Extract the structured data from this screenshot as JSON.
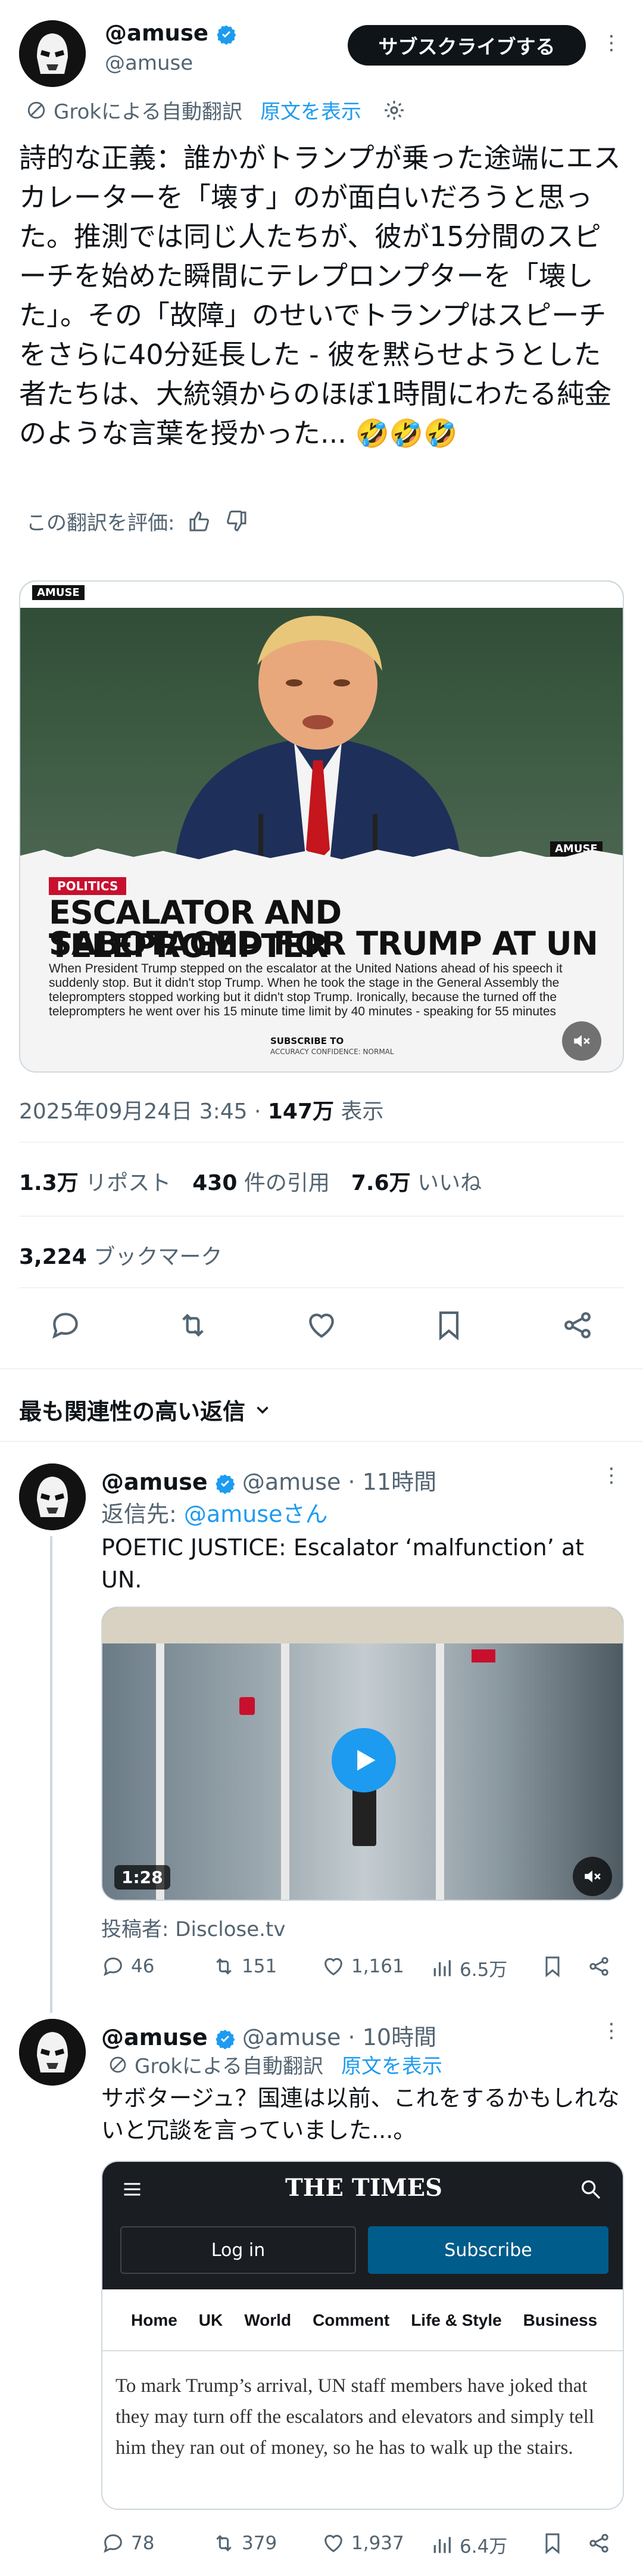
{
  "tweet": {
    "display_name": "@amuse",
    "handle": "@amuse",
    "subscribe_label": "サブスクライブする",
    "translation_note": "Grokによる自動翻訳",
    "show_original": "原文を表示",
    "text": "詩的な正義：誰かがトランプが乗った途端にエスカレーターを「壊す」のが面白いだろうと思った。推測では同じ人たちが、彼が15分間のスピーチを始めた瞬間にテレプロンプターを「壊した」。その「故障」のせいでトランプはスピーチをさらに40分延長した - 彼を黙らせようとした者たちは、大統領からのほぼ1時間にわたる純金のような言葉を授かった... 🤣🤣🤣",
    "rate_translation": "この翻訳を評価:",
    "image": {
      "brand": "AMUSE",
      "tag": "POLITICS",
      "headline_1": "ESCALATOR AND TELEPROMPTER",
      "headline_2": "SABOTAGED FOR TRUMP AT UN",
      "body": "When President Trump stepped on the escalator at the United Nations ahead of his speech it suddenly stop. But it didn't stop Trump. When he took the stage in the General Assembly the teleprompters stopped working but it didn't stop Trump. Ironically, because the turned off the teleprompters he went over his 15 minute time limit by 40 minutes - speaking for 55 minutes",
      "subscribe": "SUBSCRIBE TO",
      "confidence": "ACCURACY CONFIDENCE: NORMAL",
      "watermark": "AMUSE"
    },
    "timestamp": "2025年09月24日 3:45",
    "views_num": "147万",
    "views_label": "表示",
    "reposts_num": "1.3万",
    "reposts_label": "リポスト",
    "quotes_num": "430",
    "quotes_label": "件の引用",
    "likes_num": "7.6万",
    "likes_label": "いいね",
    "bookmarks_num": "3,224",
    "bookmarks_label": "ブックマーク"
  },
  "replies_header": "最も関連性の高い返信",
  "reply1": {
    "name": "@amuse",
    "handle": "@amuse",
    "time": "11時間",
    "reply_to_label": "返信先:",
    "reply_to_user": "@amuseさん",
    "text": "POETIC JUSTICE: Escalator ‘malfunction’ at UN.",
    "duration": "1:28",
    "source": "投稿者: Disclose.tv",
    "replies": "46",
    "reposts": "151",
    "likes": "1,161",
    "views": "6.5万"
  },
  "reply2": {
    "name": "@amuse",
    "handle": "@amuse",
    "time": "10時間",
    "translation_note": "Grokによる自動翻訳",
    "show_original": "原文を表示",
    "text": "サボタージュ？国連は以前、これをするかもしれないと冗談を言っていました...。",
    "times": {
      "logo": "THE TIMES",
      "login": "Log in",
      "subscribe": "Subscribe",
      "nav": [
        "Home",
        "UK",
        "World",
        "Comment",
        "Life & Style",
        "Business"
      ],
      "quote": "To mark Trump’s arrival, UN staff members have joked that they may turn off the escalators and elevators and simply tell him they ran out of money, so he has to walk up the stairs."
    },
    "replies": "78",
    "reposts": "379",
    "likes": "1,937",
    "views": "6.4万"
  },
  "colors": {
    "accent": "#1d9bf0",
    "text": "#0f1419",
    "secondary": "#536471",
    "headline_red": "#c8102e"
  }
}
